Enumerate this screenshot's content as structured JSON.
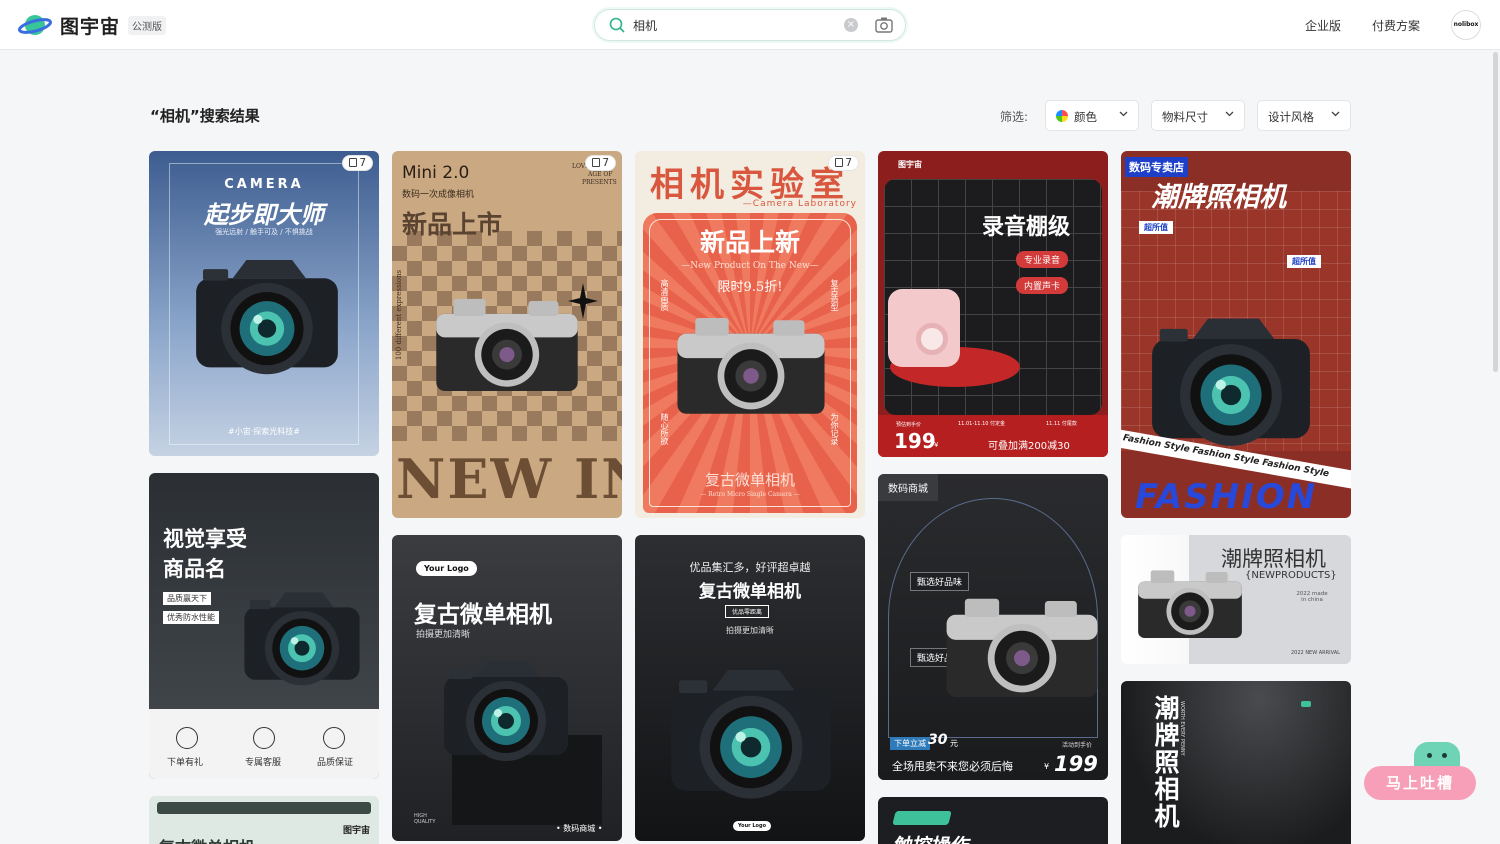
{
  "header": {
    "logo_text": "图宇宙",
    "beta_badge": "公测版",
    "search": {
      "value": "相机",
      "placeholder": ""
    },
    "nav": {
      "enterprise": "企业版",
      "pricing": "付费方案"
    },
    "avatar_text": "nolibox"
  },
  "toolbar": {
    "title": "“相机”搜索结果",
    "filter_label": "筛选:",
    "filters": {
      "color": "颜色",
      "size": "物料尺寸",
      "style": "设计风格"
    }
  },
  "cards": {
    "c1": {
      "badge": "7",
      "en_title": "CAMERA",
      "title": "起步即大师",
      "subtitle": "强光远射 / 触手可及 / 不惧挑战",
      "footer": "#小宙·探索光科技#"
    },
    "c2": {
      "badge": "7",
      "title_en": "Mini 2.0",
      "subtitle": "数码一次成像相机",
      "title": "新品上市",
      "side_tl": "LOVE",
      "side_tr": "AGE OF",
      "presents": "PRESENTS",
      "side_text": "100 different expressions",
      "big": "NEW IN"
    },
    "c3": {
      "badge": "7",
      "title": "相机实验室",
      "en": "—Camera Laboratory",
      "sub_title": "新品上新",
      "sub_en": "—New Product On The New—",
      "discount": "限时9.5折!",
      "left_v": "高清画质",
      "right_v": "复古造型",
      "left_v2": "随心所欲",
      "right_v2": "为你记录",
      "bottom": "复古微单相机",
      "bottom_en": "— Retro Micro Single Camera —"
    },
    "c4": {
      "brand": "图宇宙",
      "title": "录音棚级",
      "tag1": "专业录音",
      "tag2": "内置声卡",
      "pre_label": "预估到手价",
      "price": "199",
      "price_unit": "¥",
      "date1": "11.01-11.10 付定金",
      "date2": "11.11 付尾款",
      "promo": "可叠加满200减30"
    },
    "c5": {
      "shop_tag": "数码专卖店",
      "title": "潮牌照相机",
      "tag": "超所值",
      "tag2": "超所值",
      "ribbon": "Fashion Style Fashion Style Fashion Style",
      "big": "FASHION"
    },
    "c6": {
      "title_line1": "视觉享受",
      "title_line2": "商品名",
      "tag1": "品质赢天下",
      "tag2": "优秀防水性能",
      "f1": "下单有礼",
      "f2": "专属客服",
      "f3": "品质保证"
    },
    "c7": {
      "logo_pill": "Your Logo",
      "title": "复古微单相机",
      "subtitle": "拍摄更加清晰",
      "corner": "HIGH QUALITY",
      "shop": "• 数码商城 •"
    },
    "c8": {
      "header": "优品集汇多，好评超卓越",
      "title": "复古微单相机",
      "tag": "优品零距离",
      "subtitle": "拍摄更加清晰",
      "logo_pill": "Your Logo"
    },
    "c9": {
      "header": "数码商城",
      "tag1": "甄选好品味",
      "tag2": "甄选好品味",
      "promo_pre": "下单立减",
      "promo_num": "30",
      "promo_unit": "元",
      "slogan": "全场甩卖不来您必须后悔",
      "price_label": "活动到手价",
      "price_sym": "¥",
      "price": "199"
    },
    "c10": {
      "title": "潮牌照相机",
      "sub": "{NEWPRODUCTS}",
      "year_text": "2022 made in china",
      "footer": "2022 NEW ARRIVAL"
    },
    "c11": {
      "title": "潮牌照相机",
      "side_en": "WORTH EVERY PENNY"
    },
    "c12": {
      "brand": "图宇宙",
      "title": "复古微单相机"
    },
    "c13": {
      "title": "触控操作"
    }
  },
  "feedback": {
    "label": "马上吐槽"
  }
}
